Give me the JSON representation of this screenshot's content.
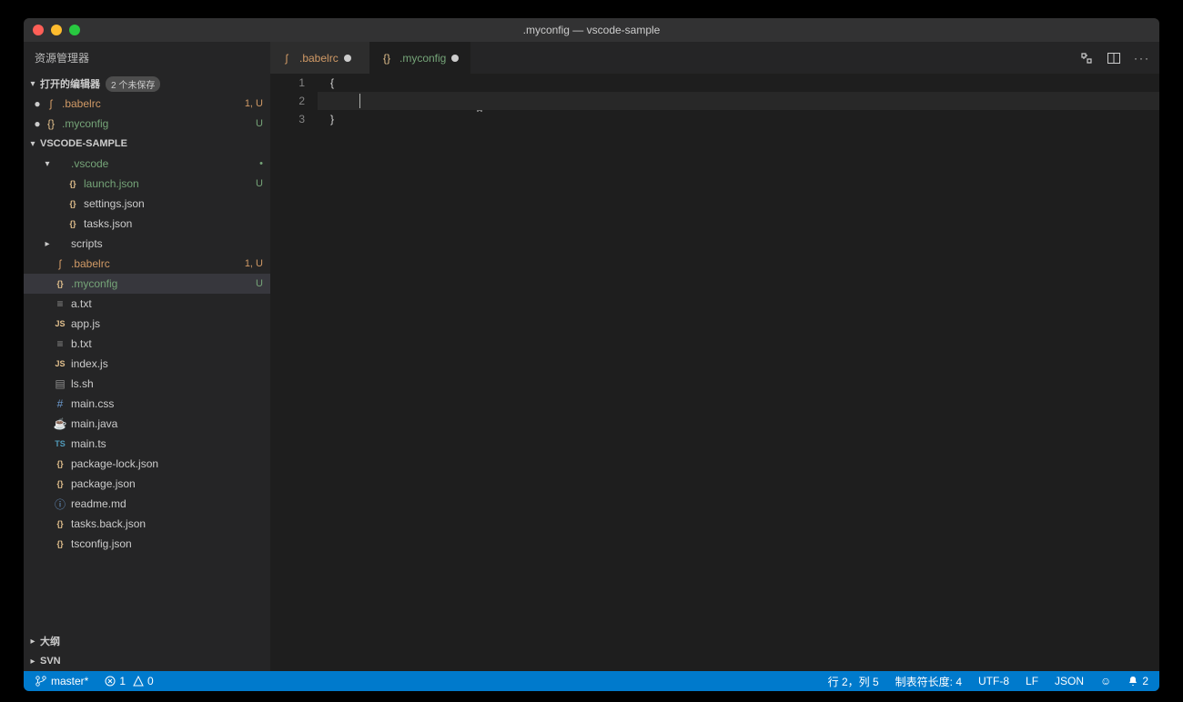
{
  "window": {
    "title": ".myconfig — vscode-sample"
  },
  "sidebar": {
    "title": "资源管理器",
    "open_editors": {
      "label": "打开的编辑器",
      "badge": "2 个未保存",
      "items": [
        {
          "dot": "●",
          "icon": "ʃ",
          "iconcls": "c-orange",
          "name": ".babelrc",
          "namecls": "c-orange",
          "meta": "1, U",
          "metacls": "red"
        },
        {
          "dot": "●",
          "icon": "{}",
          "iconcls": "c-yellow",
          "name": ".myconfig",
          "namecls": "c-green",
          "meta": "U",
          "metacls": ""
        }
      ]
    },
    "workspace": {
      "label": "VSCODE-SAMPLE",
      "tree": [
        {
          "indent": 1,
          "arrow": "▾",
          "icon": "",
          "iconcls": "",
          "name": ".vscode",
          "namecls": "c-green",
          "meta": "•",
          "metacls": ""
        },
        {
          "indent": 2,
          "arrow": "",
          "icon": "{}",
          "iconcls": "c-yellow",
          "name": "launch.json",
          "namecls": "c-green",
          "meta": "U",
          "metacls": ""
        },
        {
          "indent": 2,
          "arrow": "",
          "icon": "{}",
          "iconcls": "c-yellow",
          "name": "settings.json",
          "namecls": "",
          "meta": "",
          "metacls": ""
        },
        {
          "indent": 2,
          "arrow": "",
          "icon": "{}",
          "iconcls": "c-yellow",
          "name": "tasks.json",
          "namecls": "",
          "meta": "",
          "metacls": ""
        },
        {
          "indent": 1,
          "arrow": "▸",
          "icon": "",
          "iconcls": "",
          "name": "scripts",
          "namecls": "",
          "meta": "",
          "metacls": ""
        },
        {
          "indent": 1,
          "arrow": "",
          "icon": "ʃ",
          "iconcls": "c-orange",
          "name": ".babelrc",
          "namecls": "c-orange",
          "meta": "1, U",
          "metacls": "red"
        },
        {
          "indent": 1,
          "arrow": "",
          "icon": "{}",
          "iconcls": "c-yellow",
          "name": ".myconfig",
          "namecls": "c-green",
          "meta": "U",
          "metacls": "",
          "selected": true
        },
        {
          "indent": 1,
          "arrow": "",
          "icon": "≡",
          "iconcls": "c-gray",
          "name": "a.txt",
          "namecls": "",
          "meta": "",
          "metacls": ""
        },
        {
          "indent": 1,
          "arrow": "",
          "icon": "JS",
          "iconcls": "c-yellow",
          "name": "app.js",
          "namecls": "",
          "meta": "",
          "metacls": ""
        },
        {
          "indent": 1,
          "arrow": "",
          "icon": "≡",
          "iconcls": "c-gray",
          "name": "b.txt",
          "namecls": "",
          "meta": "",
          "metacls": ""
        },
        {
          "indent": 1,
          "arrow": "",
          "icon": "JS",
          "iconcls": "c-yellow",
          "name": "index.js",
          "namecls": "",
          "meta": "",
          "metacls": ""
        },
        {
          "indent": 1,
          "arrow": "",
          "icon": "▤",
          "iconcls": "c-gray",
          "name": "ls.sh",
          "namecls": "",
          "meta": "",
          "metacls": ""
        },
        {
          "indent": 1,
          "arrow": "",
          "icon": "#",
          "iconcls": "c-lblue",
          "name": "main.css",
          "namecls": "",
          "meta": "",
          "metacls": ""
        },
        {
          "indent": 1,
          "arrow": "",
          "icon": "☕",
          "iconcls": "c-red",
          "name": "main.java",
          "namecls": "",
          "meta": "",
          "metacls": ""
        },
        {
          "indent": 1,
          "arrow": "",
          "icon": "TS",
          "iconcls": "c-blue",
          "name": "main.ts",
          "namecls": "",
          "meta": "",
          "metacls": ""
        },
        {
          "indent": 1,
          "arrow": "",
          "icon": "{}",
          "iconcls": "c-yellow",
          "name": "package-lock.json",
          "namecls": "",
          "meta": "",
          "metacls": ""
        },
        {
          "indent": 1,
          "arrow": "",
          "icon": "{}",
          "iconcls": "c-yellow",
          "name": "package.json",
          "namecls": "",
          "meta": "",
          "metacls": ""
        },
        {
          "indent": 1,
          "arrow": "",
          "icon": "ⓘ",
          "iconcls": "c-lblue",
          "name": "readme.md",
          "namecls": "",
          "meta": "",
          "metacls": ""
        },
        {
          "indent": 1,
          "arrow": "",
          "icon": "{}",
          "iconcls": "c-yellow",
          "name": "tasks.back.json",
          "namecls": "",
          "meta": "",
          "metacls": ""
        },
        {
          "indent": 1,
          "arrow": "",
          "icon": "{}",
          "iconcls": "c-yellow",
          "name": "tsconfig.json",
          "namecls": "",
          "meta": "",
          "metacls": ""
        }
      ]
    },
    "bottom": [
      {
        "label": "大纲"
      },
      {
        "label": "SVN"
      }
    ]
  },
  "tabs": [
    {
      "icon": "ʃ",
      "iconcls": "c-orange",
      "name": ".babelrc",
      "namecls": "c-orange",
      "dirty": true,
      "active": false
    },
    {
      "icon": "{}",
      "iconcls": "c-yellow",
      "name": ".myconfig",
      "namecls": "c-green",
      "dirty": true,
      "active": true
    }
  ],
  "editor": {
    "lines": [
      {
        "num": "1",
        "text": "{"
      },
      {
        "num": "2",
        "text": "",
        "hl": true,
        "cursorcol": 5
      },
      {
        "num": "3",
        "text": "}"
      }
    ]
  },
  "statusbar": {
    "branch": "master*",
    "errors": "1",
    "warnings": "0",
    "cursor": "行 2，列 5",
    "tabsize": "制表符长度: 4",
    "encoding": "UTF-8",
    "eol": "LF",
    "lang": "JSON",
    "feedback": "☺",
    "bell_count": "2"
  }
}
